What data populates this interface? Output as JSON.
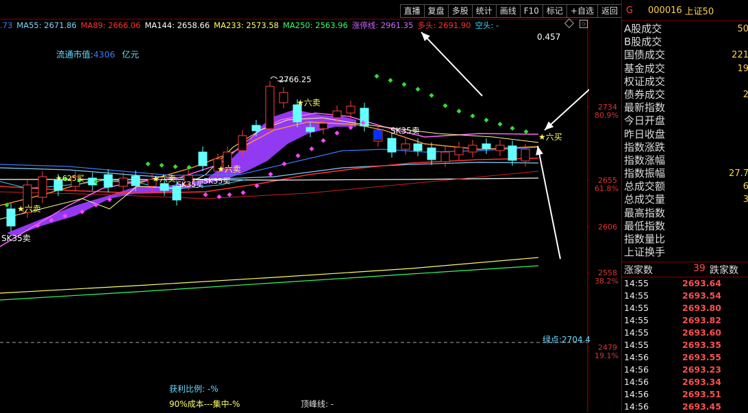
{
  "toolbar": {
    "buttons": [
      "直播",
      "复盘",
      "多股",
      "统计",
      "画线",
      "F10",
      "标记",
      "+自选",
      "返回"
    ]
  },
  "ma_legend": [
    {
      "text": ".73",
      "color": "#3a7bff"
    },
    {
      "text": "MA55: 2671.86",
      "color": "#7fd4ff"
    },
    {
      "text": "MA89: 2666.06",
      "color": "#ff3030"
    },
    {
      "text": "MA144: 2658.66",
      "color": "#ffffff"
    },
    {
      "text": "MA233: 2573.58",
      "color": "#ffff66"
    },
    {
      "text": "MA250: 2563.96",
      "color": "#33ff66"
    },
    {
      "text": "涨停线: 2961.35",
      "color": "#cc66ff"
    },
    {
      "text": "多头: 2691.90",
      "color": "#ff3030"
    },
    {
      "text": "空头: -",
      "color": "#33ddff"
    }
  ],
  "chart": {
    "ratio_value": "0.457",
    "float_cap_label": "流通市值:",
    "float_cap_value": "4306",
    "float_cap_unit": "亿元",
    "peak_label": "2766.25",
    "green_point": "绿点:2704.4",
    "signals": {
      "six_sell": "★六卖",
      "six_buy": "★六买",
      "sk35_sell": "SK35卖",
      "sk35_buy": "SK35买",
      "six25_buy": "★625买"
    },
    "axis": [
      {
        "price": "2734",
        "pct": "80.9%"
      },
      {
        "price": "2655",
        "pct": "61.8%"
      },
      {
        "price": "2606",
        "pct": ""
      },
      {
        "price": "2558",
        "pct": "38.2%"
      },
      {
        "price": "2479",
        "pct": "19.1%"
      }
    ],
    "bottom": {
      "profit_ratio": "获利比例: -%",
      "cost_90": "90%成本---集中-%",
      "peak_line": "顶峰线: -"
    }
  },
  "sidebar": {
    "badge": "G",
    "code": "000016",
    "name": "上证50",
    "stats": [
      {
        "label": "A股成交",
        "value": "50"
      },
      {
        "label": "B股成交",
        "value": ""
      },
      {
        "label": "国债成交",
        "value": "221"
      },
      {
        "label": "基金成交",
        "value": "19"
      },
      {
        "label": "权证成交",
        "value": ""
      },
      {
        "label": "债券成交",
        "value": "2"
      },
      {
        "label": "最新指数",
        "value": ""
      },
      {
        "label": "今日开盘",
        "value": ""
      },
      {
        "label": "昨日收盘",
        "value": ""
      },
      {
        "label": "指数涨跌",
        "value": ""
      },
      {
        "label": "指数涨幅",
        "value": ""
      },
      {
        "label": "指数振幅",
        "value": "27.7"
      },
      {
        "label": "总成交额",
        "value": "6"
      },
      {
        "label": "总成交量",
        "value": "3"
      },
      {
        "label": "最高指数",
        "value": ""
      },
      {
        "label": "最低指数",
        "value": ""
      },
      {
        "label": "指数量比",
        "value": ""
      },
      {
        "label": "上证换手",
        "value": ""
      }
    ],
    "breadth": {
      "up_label": "涨家数",
      "up_count": "39",
      "down_label": "跌家数"
    },
    "ticks": [
      {
        "time": "14:55",
        "price": "2693.64"
      },
      {
        "time": "14:55",
        "price": "2693.54"
      },
      {
        "time": "14:55",
        "price": "2693.80"
      },
      {
        "time": "14:55",
        "price": "2693.82"
      },
      {
        "time": "14:55",
        "price": "2693.60"
      },
      {
        "time": "14:55",
        "price": "2693.35"
      },
      {
        "time": "14:56",
        "price": "2693.55"
      },
      {
        "time": "14:56",
        "price": "2693.23"
      },
      {
        "time": "14:56",
        "price": "2693.34"
      },
      {
        "time": "14:56",
        "price": "2693.51"
      },
      {
        "time": "14:56",
        "price": "2693.45"
      }
    ]
  }
}
